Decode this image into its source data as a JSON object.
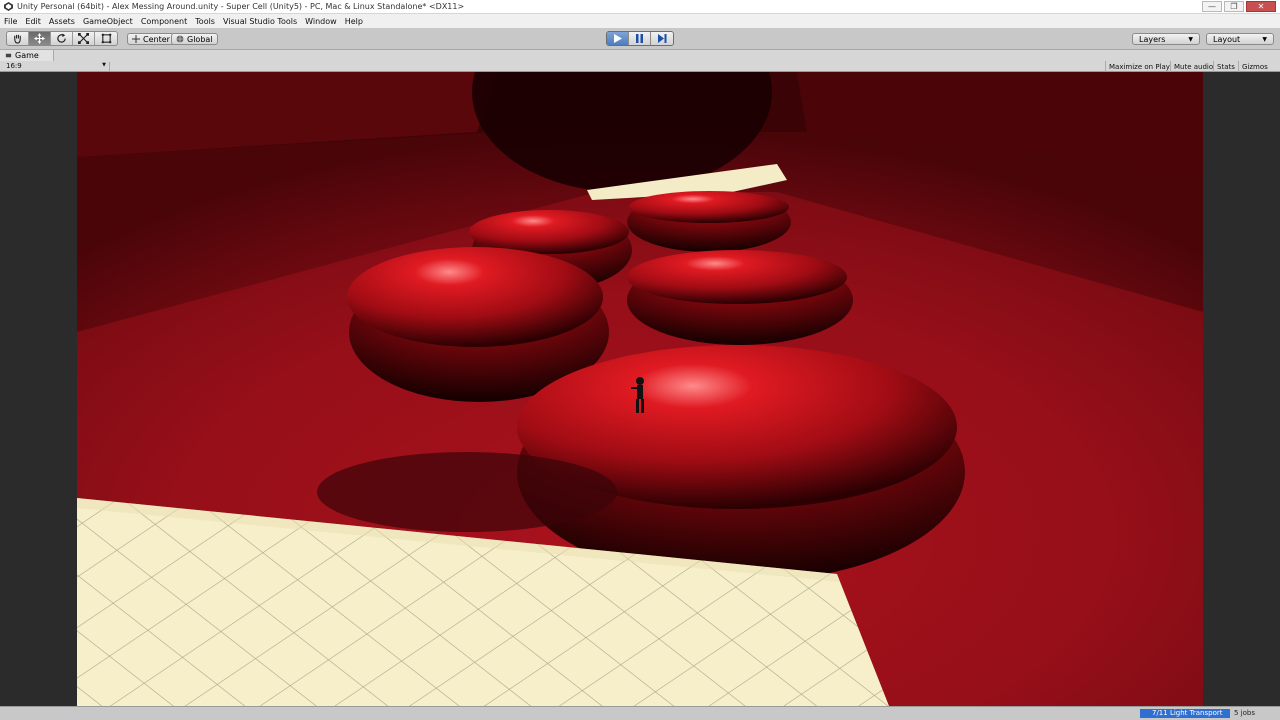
{
  "window": {
    "title": "Unity Personal (64bit) - Alex Messing Around.unity - Super Cell (Unity5) - PC, Mac & Linux Standalone* <DX11>",
    "minimize": "—",
    "restore": "❐",
    "close": "✕"
  },
  "menu": [
    "File",
    "Edit",
    "Assets",
    "GameObject",
    "Component",
    "Tools",
    "Visual Studio Tools",
    "Window",
    "Help"
  ],
  "toolbar": {
    "tools": [
      "hand-tool-icon",
      "move-tool-icon",
      "rotate-tool-icon",
      "scale-tool-icon",
      "rect-tool-icon"
    ],
    "active_tool": 1,
    "pivot_mode": "Center",
    "pivot_rotation": "Global",
    "play_state": "playing",
    "layers": "Layers",
    "layout": "Layout"
  },
  "game": {
    "tab_label": "Game",
    "aspect": "16:9",
    "maximize_on_play": "Maximize on Play",
    "mute_audio": "Mute audio",
    "stats": "Stats",
    "gizmos": "Gizmos"
  },
  "status": {
    "progress": "7/11 Light Transport",
    "jobs": "5 jobs",
    "progress_value": 0.64
  },
  "colors": {
    "floor_red": "#8a0d16",
    "cell_red": "#c1121b",
    "platform_cream": "#f7efc9",
    "play_blue": "#4d7cc0"
  }
}
